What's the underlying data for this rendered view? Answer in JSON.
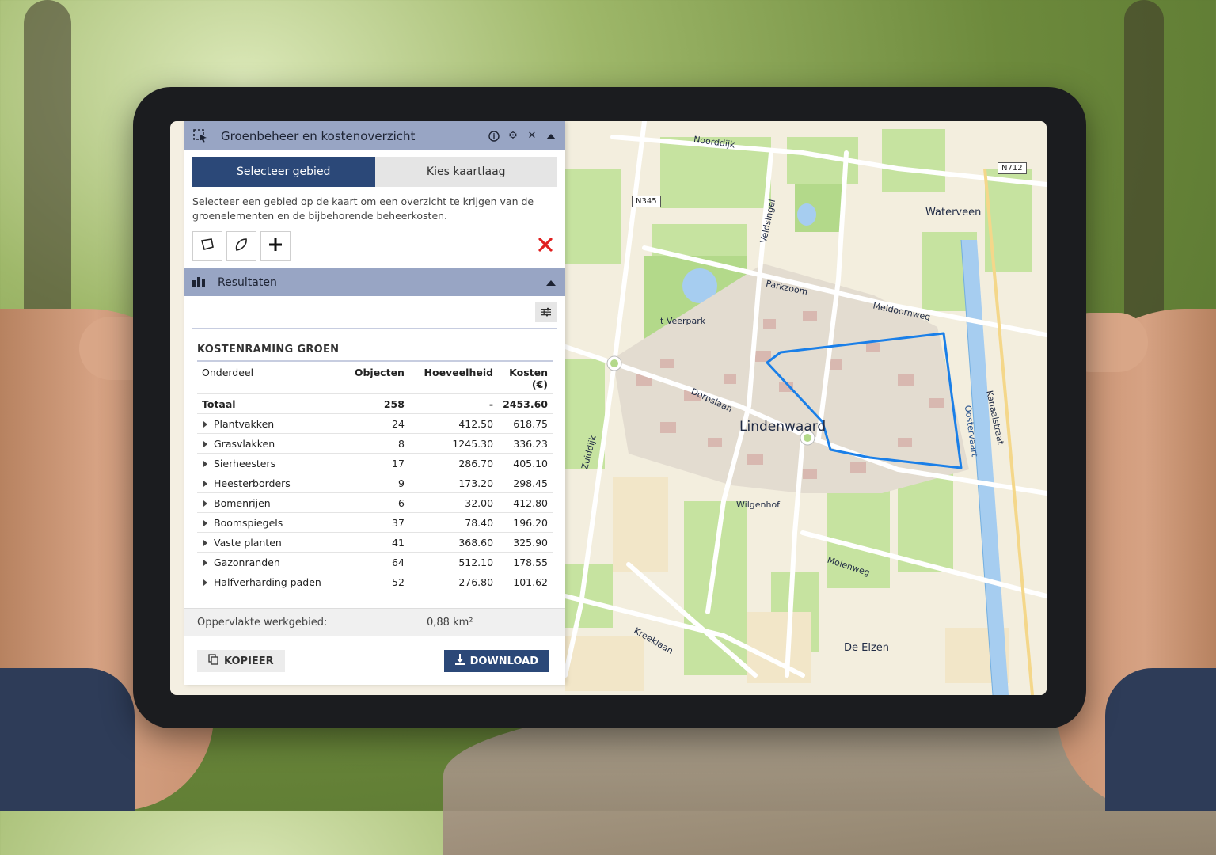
{
  "panel": {
    "title": "Groenbeheer en kostenoverzicht",
    "tabs": [
      {
        "label": "Selecteer gebied",
        "active": true
      },
      {
        "label": "Kies kaartlaag",
        "active": false
      }
    ],
    "description": "Selecteer een gebied op de kaart om een overzicht te krijgen van de groenelementen en de bijbehorende beheerkosten.",
    "tools": [
      {
        "icon": "polygon-select-icon"
      },
      {
        "icon": "freehand-select-icon"
      },
      {
        "icon": "plus-icon"
      }
    ],
    "delete_icon": "close-red-icon"
  },
  "results": {
    "title": "Resultaten",
    "cost_title": "KOSTENRAMING GROEN",
    "columns": {
      "name": "Onderdeel",
      "objects": "Objecten",
      "quantity": "Hoeveelheid",
      "cost": "Kosten (€)"
    },
    "total": {
      "name": "Totaal",
      "objects": "258",
      "quantity": "-",
      "cost": "2453.60"
    },
    "rows": [
      {
        "name": "Plantvakken",
        "objects": "24",
        "quantity": "412.50",
        "cost": "618.75"
      },
      {
        "name": "Grasvlakken",
        "objects": "8",
        "quantity": "1245.30",
        "cost": "336.23"
      },
      {
        "name": "Sierheesters",
        "objects": "17",
        "quantity": "286.70",
        "cost": "405.10"
      },
      {
        "name": "Heesterborders",
        "objects": "9",
        "quantity": "173.20",
        "cost": "298.45"
      },
      {
        "name": "Bomenrijen",
        "objects": "6",
        "quantity": "32.00",
        "cost": "412.80"
      },
      {
        "name": "Boomspiegels",
        "objects": "37",
        "quantity": "78.40",
        "cost": "196.20"
      },
      {
        "name": "Vaste planten",
        "objects": "41",
        "quantity": "368.60",
        "cost": "325.90"
      },
      {
        "name": "Gazonranden",
        "objects": "64",
        "quantity": "512.10",
        "cost": "178.55"
      },
      {
        "name": "Halfverharding paden",
        "objects": "52",
        "quantity": "276.80",
        "cost": "101.62"
      }
    ],
    "area_label": "Oppervlakte werkgebied:",
    "area_value": "0,88 km²",
    "copy_label": "KOPIEER",
    "download_label": "DOWNLOAD"
  },
  "map": {
    "roads": [
      "Noorddijk",
      "Veldsingel",
      "Parkzoom",
      "Meidoornweg",
      "Dorpslaan",
      "Zuiddijk",
      "Molenweg",
      "Kreeklaan",
      "Kanaalstraat",
      "Oostervaart"
    ],
    "places": [
      "Waterveen",
      "'t Veerpark",
      "Wilgenhof",
      "De Elzen"
    ],
    "town": "Lindenwaard",
    "shields": [
      "N345",
      "N712"
    ],
    "selection_color": "#1a7fe8"
  }
}
